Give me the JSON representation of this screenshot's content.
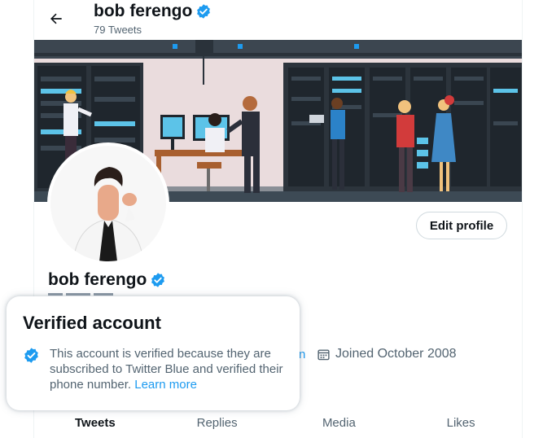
{
  "header": {
    "name": "bob ferengo",
    "tweet_count": "79 Tweets"
  },
  "profile": {
    "name": "bob ferengo",
    "edit_profile_label": "Edit profile",
    "joined_text": "Joined October 2008",
    "partial_link_text": "n"
  },
  "tabs": [
    {
      "label": "Tweets",
      "active": true
    },
    {
      "label": "Replies",
      "active": false
    },
    {
      "label": "Media",
      "active": false
    },
    {
      "label": "Likes",
      "active": false
    }
  ],
  "hovercard": {
    "title": "Verified account",
    "text": "This account is verified because they are subscribed to Twitter Blue and verified their phone number.",
    "link_label": "Learn more"
  },
  "colors": {
    "verified_blue": "#1d9bf0",
    "secondary_text": "#536471",
    "banner_background": "#eadcdd"
  },
  "icons": [
    "back-arrow-icon",
    "verified-badge-icon",
    "calendar-icon"
  ]
}
